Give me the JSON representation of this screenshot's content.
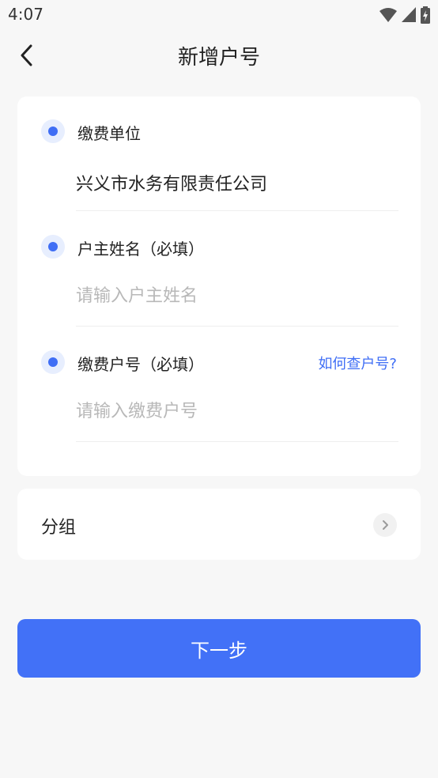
{
  "status_bar": {
    "time": "4:07",
    "icons": [
      "wifi-icon",
      "cellular-signal-icon",
      "battery-charging-icon"
    ]
  },
  "header": {
    "title": "新增户号",
    "back_icon": "chevron-left-icon"
  },
  "form": {
    "unit": {
      "label": "缴费单位",
      "value": "兴义市水务有限责任公司"
    },
    "owner_name": {
      "label": "户主姓名（必填）",
      "value": "",
      "placeholder": "请输入户主姓名"
    },
    "account_number": {
      "label": "缴费户号（必填）",
      "value": "",
      "placeholder": "请输入缴费户号",
      "help_link": "如何查户号?"
    }
  },
  "group": {
    "label": "分组",
    "chevron_icon": "chevron-right-icon"
  },
  "next_button": {
    "label": "下一步"
  },
  "colors": {
    "accent": "#4271f7",
    "background": "#f7f7f7",
    "card": "#ffffff",
    "placeholder": "#b8b8b8",
    "dot_bg": "#e7eefe"
  }
}
